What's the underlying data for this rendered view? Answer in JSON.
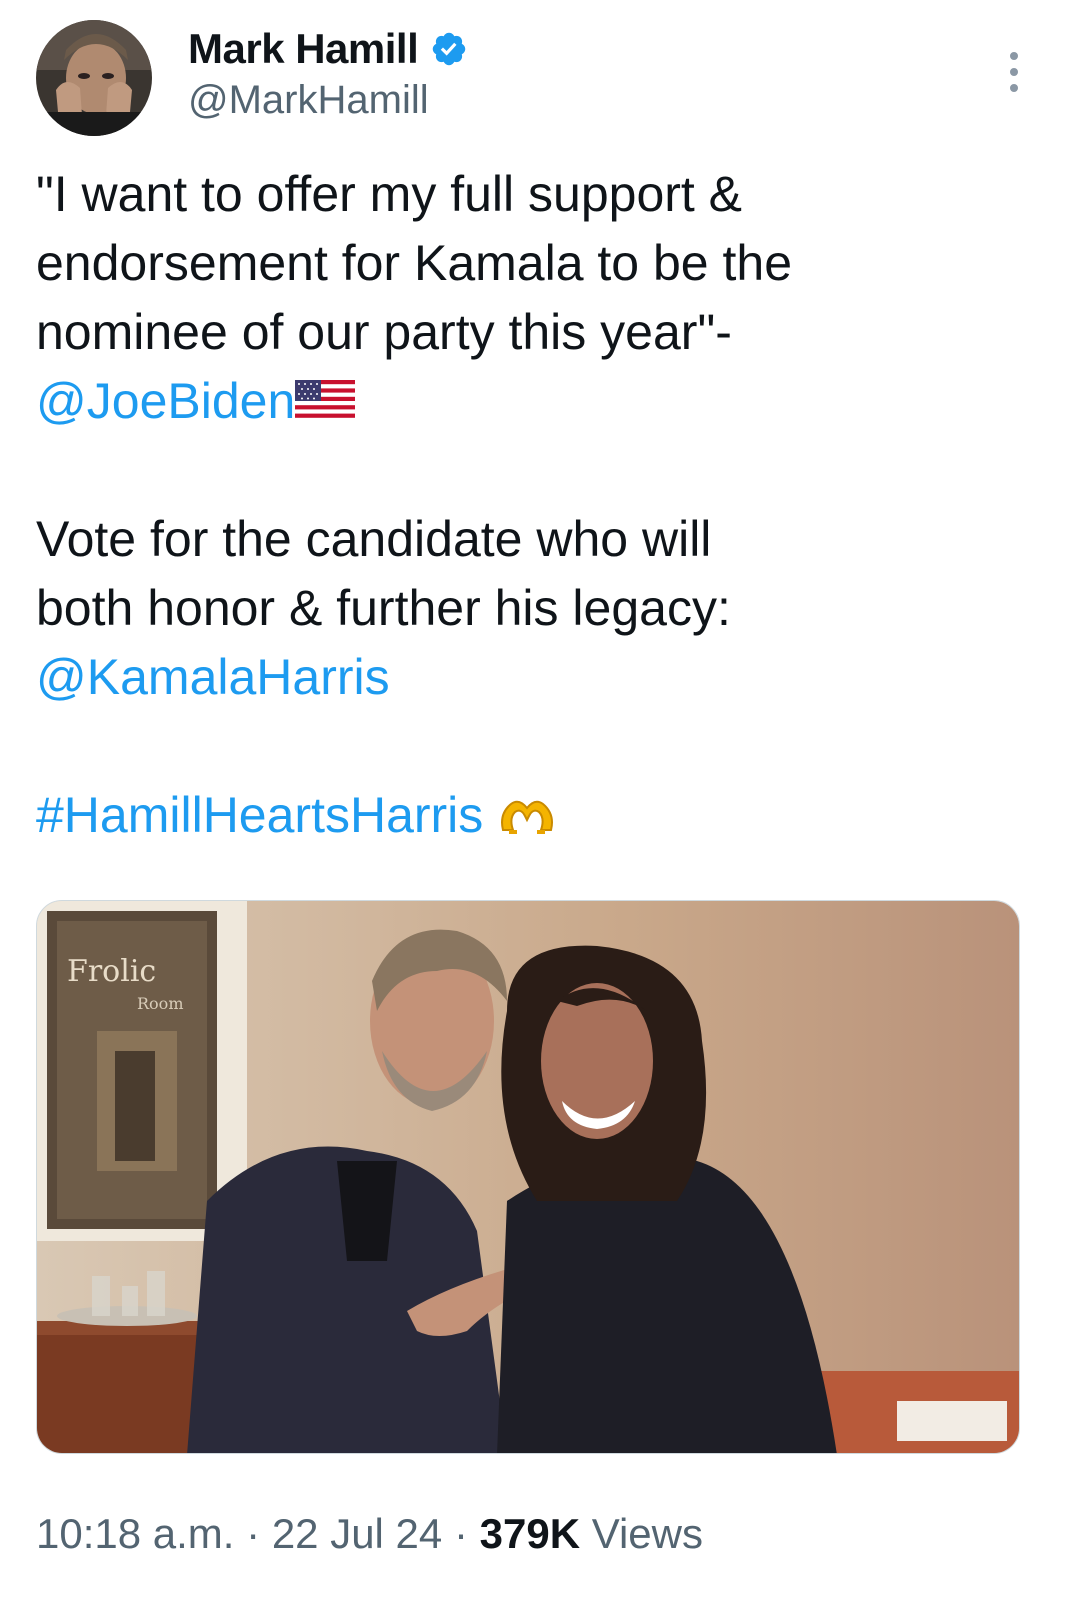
{
  "author": {
    "display_name": "Mark Hamill",
    "handle": "@MarkHamill",
    "verified": true
  },
  "tweet": {
    "lines": [
      "\"I want to offer my full support &",
      "endorsement for Kamala to be the",
      "nominee of our party this year\"-"
    ],
    "mention_1": "@JoeBiden",
    "mention_1_emoji": "us-flag-icon",
    "lines_2": [
      "Vote for the candidate who will",
      "both honor & further his legacy:"
    ],
    "mention_2": "@KamalaHarris",
    "hashtag": "#HamillHeartsHarris",
    "hashtag_emoji": "heart-hands-icon"
  },
  "media": {
    "poster_text_1": "Frolic",
    "poster_text_2": "Room"
  },
  "meta": {
    "time": "10:18 a.m.",
    "sep1": "·",
    "date": "22 Jul 24",
    "sep2": "·",
    "views_count": "379K",
    "views_label": "Views"
  },
  "colors": {
    "link": "#1d9bf0",
    "text": "#0f1419",
    "secondary": "#536471",
    "verified": "#1d9bf0"
  }
}
